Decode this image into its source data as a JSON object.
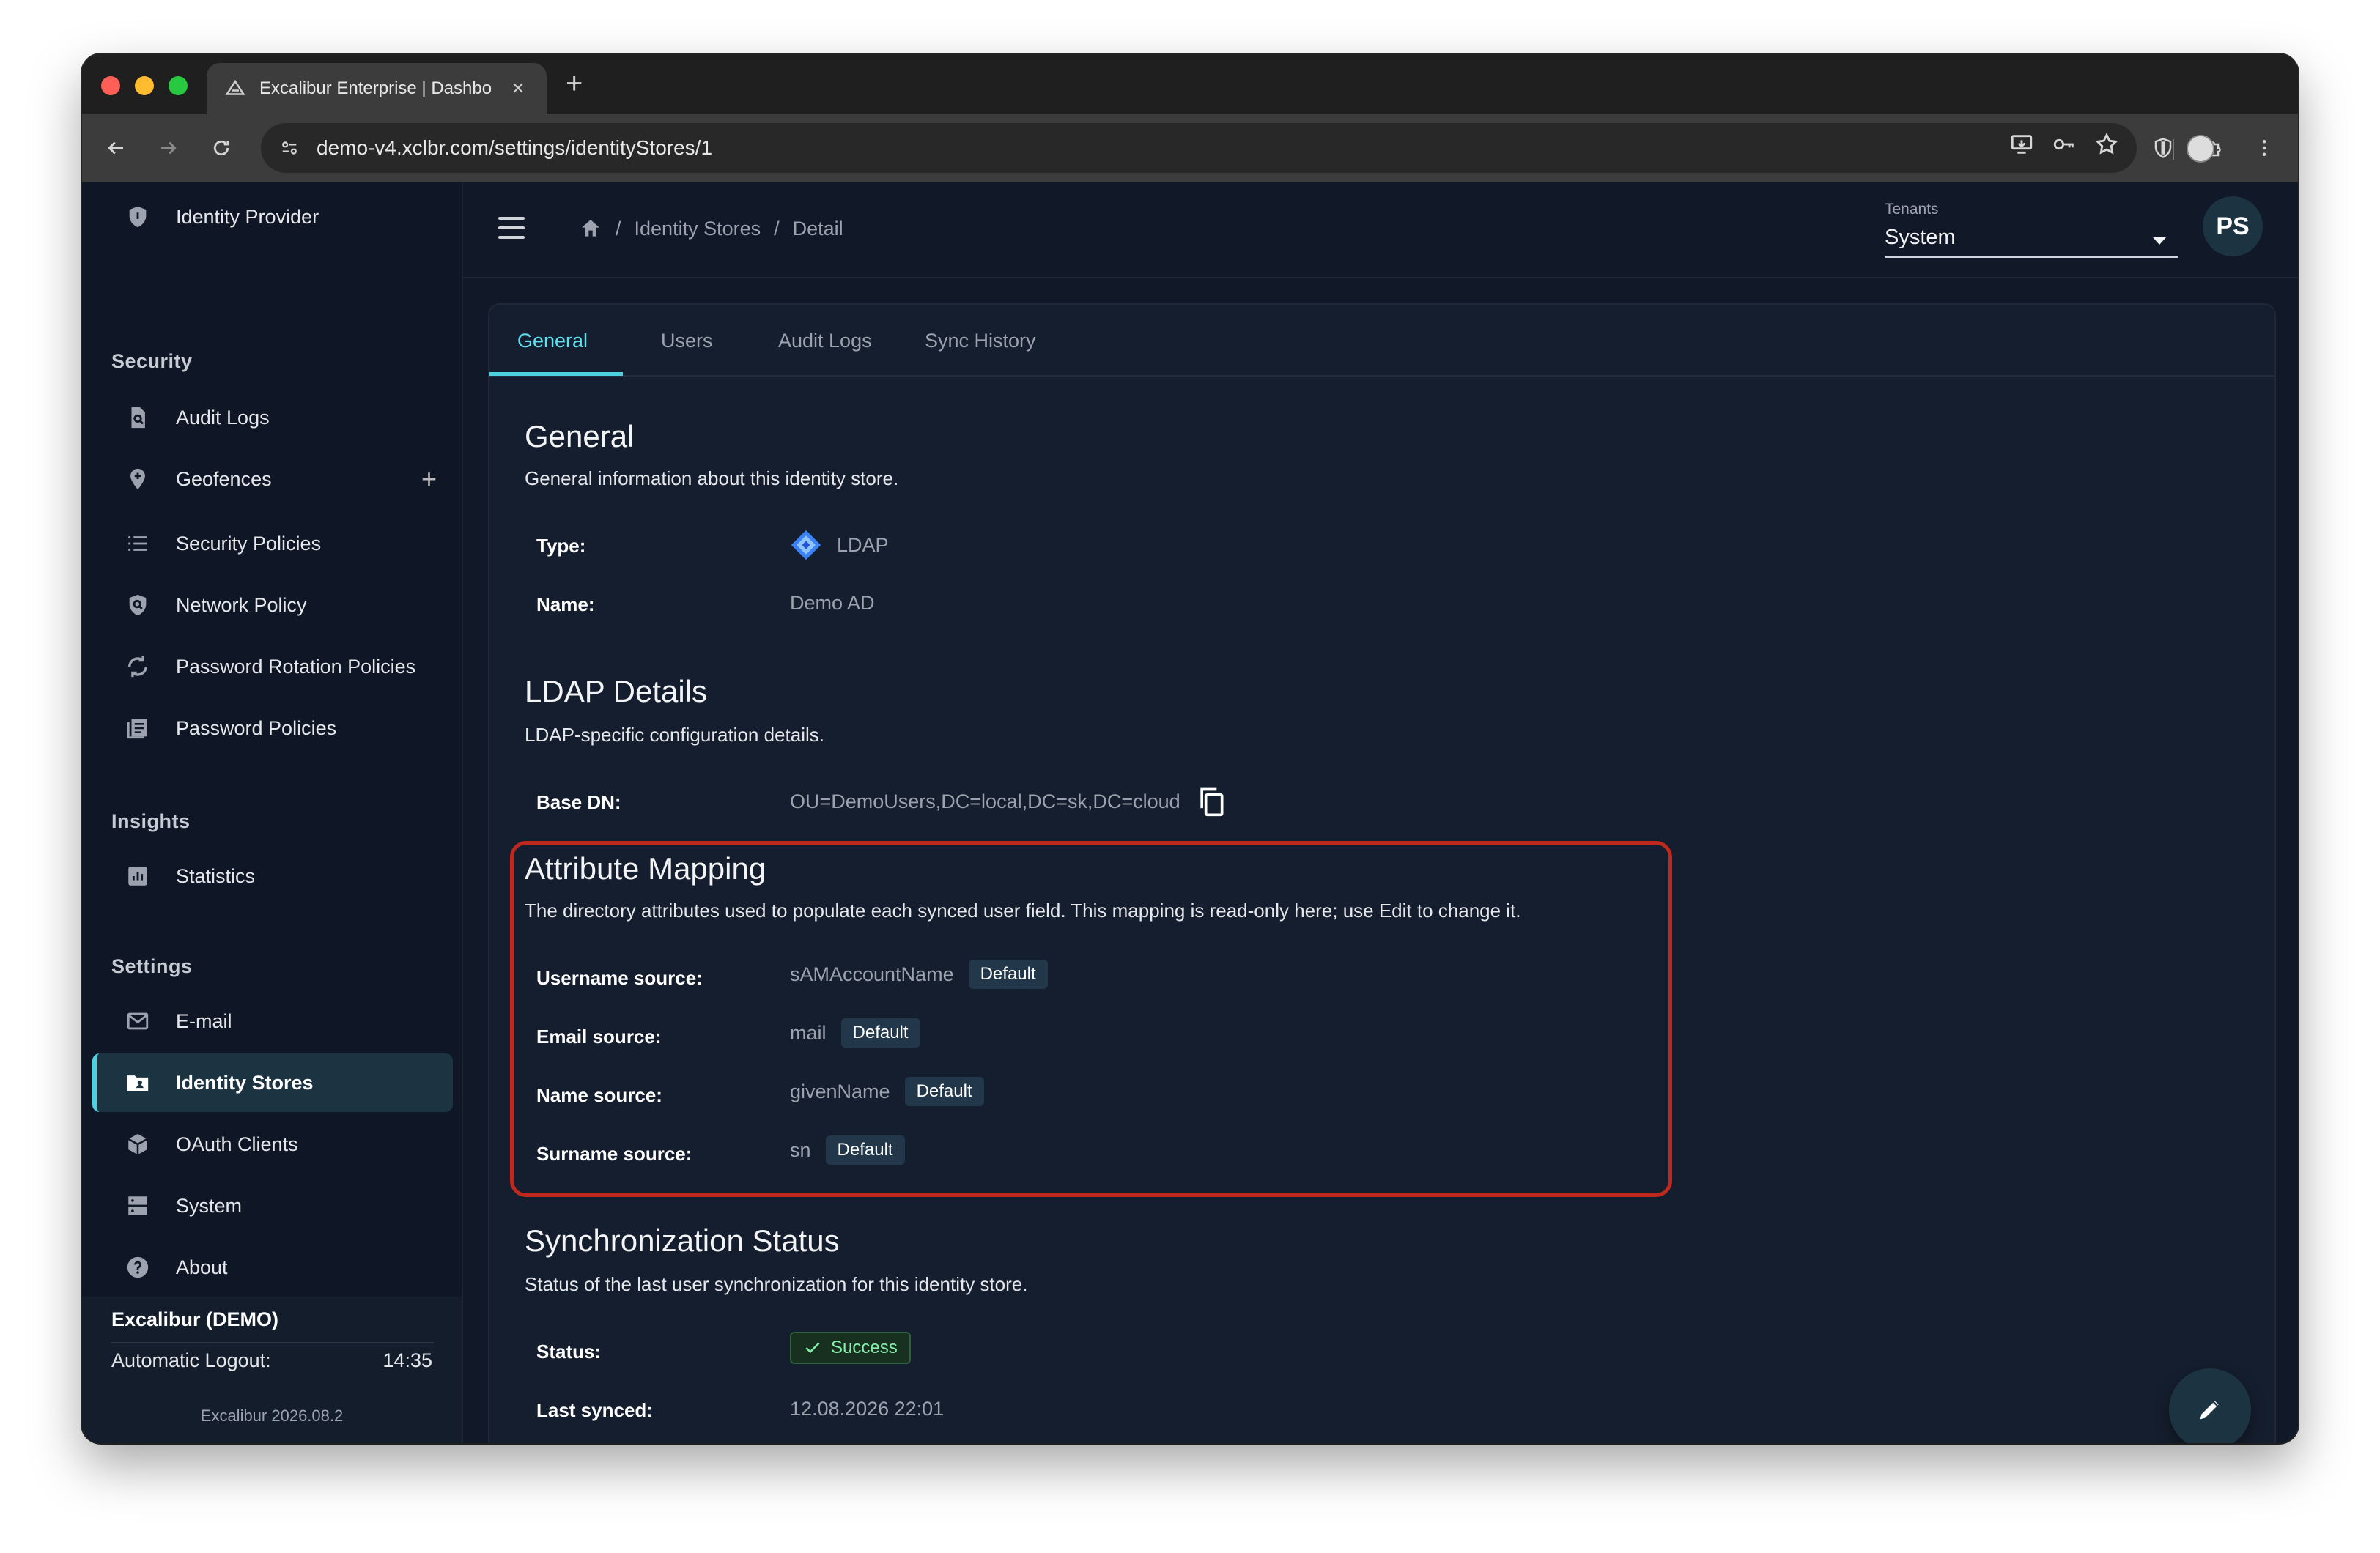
{
  "browser": {
    "tab_title": "Excalibur Enterprise | Dashbo",
    "url": "demo-v4.xclbr.com/settings/identityStores/1"
  },
  "sidebar": {
    "top_item": "Identity Provider",
    "sections": [
      {
        "title": "Security",
        "items": [
          "Audit Logs",
          "Geofences",
          "Security Policies",
          "Network Policy",
          "Password Rotation Policies",
          "Password Policies"
        ]
      },
      {
        "title": "Insights",
        "items": [
          "Statistics"
        ]
      },
      {
        "title": "Settings",
        "items": [
          "E-mail",
          "Identity Stores",
          "OAuth Clients",
          "System",
          "About"
        ]
      }
    ],
    "active_item": "Identity Stores",
    "footer": {
      "title": "Excalibur (DEMO)",
      "logout_label": "Automatic Logout:",
      "logout_time": "14:35",
      "version": "Excalibur 2026.08.2"
    }
  },
  "header": {
    "breadcrumbs": [
      "Identity Stores",
      "Detail"
    ],
    "tenant_label": "Tenants",
    "tenant_value": "System",
    "user_initials": "PS"
  },
  "tabs": [
    "General",
    "Users",
    "Audit Logs",
    "Sync History"
  ],
  "general": {
    "title": "General",
    "subtitle": "General information about this identity store.",
    "type_label": "Type:",
    "type_value": "LDAP",
    "name_label": "Name:",
    "name_value": "Demo AD"
  },
  "ldap": {
    "title": "LDAP Details",
    "subtitle": "LDAP-specific configuration details.",
    "base_dn_label": "Base DN:",
    "base_dn_value": "OU=DemoUsers,DC=local,DC=sk,DC=cloud"
  },
  "mapping": {
    "title": "Attribute Mapping",
    "subtitle": "The directory attributes used to populate each synced user field. This mapping is read-only here; use Edit to change it.",
    "rows": [
      {
        "label": "Username source:",
        "value": "sAMAccountName",
        "badge": "Default"
      },
      {
        "label": "Email source:",
        "value": "mail",
        "badge": "Default"
      },
      {
        "label": "Name source:",
        "value": "givenName",
        "badge": "Default"
      },
      {
        "label": "Surname source:",
        "value": "sn",
        "badge": "Default"
      }
    ]
  },
  "sync": {
    "title": "Synchronization Status",
    "subtitle": "Status of the last user synchronization for this identity store.",
    "status_label": "Status:",
    "status_value": "Success",
    "last_synced_label": "Last synced:",
    "last_synced_value": "12.08.2026 22:01"
  },
  "colors": {
    "accent": "#4dd0e1",
    "highlight": "#c0281e",
    "background": "#111827"
  }
}
